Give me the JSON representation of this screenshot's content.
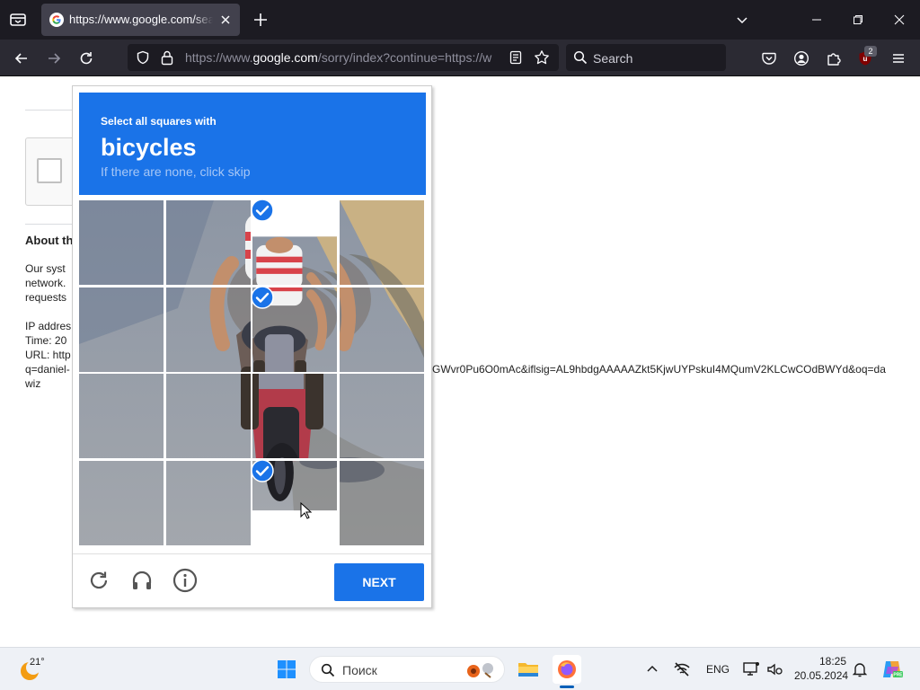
{
  "browser": {
    "tab_title": "https://www.google.com/sear",
    "url": {
      "prefix": "https://www.",
      "domain": "google.com",
      "rest": "/sorry/index?continue=https://w"
    },
    "search_placeholder": "Search",
    "extension_badge": "2"
  },
  "page": {
    "about_title": "About th",
    "body_lines": [
      "Our syst",
      "network.",
      "requests",
      "",
      "IP addres",
      "Time: 20",
      "URL: http",
      "q=daniel-",
      "wiz"
    ],
    "url_tail": "GWvr0Pu6O0mAc&iflsig=AL9hbdgAAAAAZkt5KjwUYPskuI4MQumV2KLCwCOdBWYd&oq=da"
  },
  "captcha": {
    "instruction": "Select all squares with",
    "keyword": "bicycles",
    "hint": "If there are none, click skip",
    "selected_tiles": [
      2,
      6,
      14
    ],
    "next_label": "NEXT",
    "colors": {
      "header": "#1a73e8",
      "check": "#1a73e8"
    }
  },
  "taskbar": {
    "temperature": "21°",
    "search_placeholder": "Поиск",
    "language": "ENG",
    "time": "18:25",
    "date": "20.05.2024"
  }
}
